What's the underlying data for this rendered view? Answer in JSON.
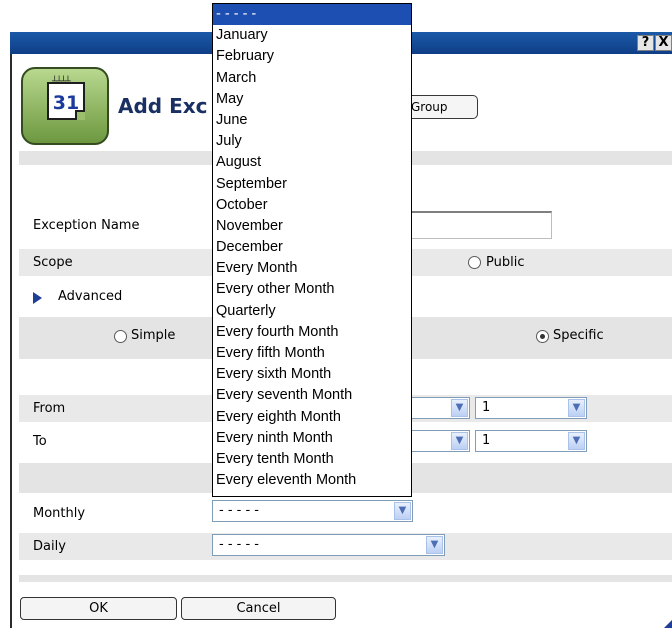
{
  "window": {
    "help_button": "?",
    "close_button": "X"
  },
  "header": {
    "title": "Add Exc",
    "group_button": "Group"
  },
  "form": {
    "exception_name_label": "Exception Name",
    "scope_label": "Scope",
    "public_label": "Public",
    "advanced_label": "Advanced",
    "simple_label": "Simple",
    "specific_label": "Specific",
    "from_label": "From",
    "to_label": "To",
    "from_day_value": "1",
    "to_day_value": "1",
    "monthly_label": "Monthly",
    "monthly_value": "- - - - -",
    "daily_label": "Daily",
    "daily_value": "- - - - -",
    "selected_radio": "Specific"
  },
  "buttons": {
    "ok": "OK",
    "cancel": "Cancel"
  },
  "icon": {
    "calendar_day": "31",
    "name": "calendar-icon"
  },
  "dropdown": {
    "selected": "- - - - -",
    "options": [
      "- - - - -",
      "January",
      "February",
      "March",
      "May",
      "June",
      "July",
      "August",
      "September",
      "October",
      "November",
      "December",
      "Every Month",
      "Every other Month",
      "Quarterly",
      "Every fourth Month",
      "Every fifth Month",
      "Every sixth Month",
      "Every seventh Month",
      "Every eighth Month",
      "Every ninth Month",
      "Every tenth Month",
      "Every eleventh Month"
    ]
  },
  "colors": {
    "titlebar": "#1b5aa8",
    "dropdown_highlight": "#1d4fb2",
    "title_text": "#1a2f62"
  }
}
